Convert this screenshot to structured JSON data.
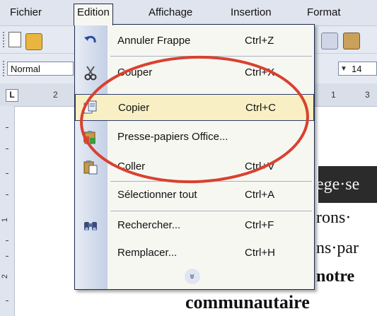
{
  "menubar": {
    "items": [
      "Fichier",
      "Edition",
      "Affichage",
      "Insertion",
      "Format"
    ]
  },
  "toolbar": {
    "style_value": "Normal",
    "font_size_value": "14"
  },
  "ruler": {
    "tab_selector": "L",
    "h_marks": [
      "2",
      "1",
      "3"
    ],
    "v_marks": [
      "1",
      "2"
    ]
  },
  "document": {
    "lines": [
      "ege·se",
      "rons·",
      "ns·par",
      "notre",
      "communautaire"
    ]
  },
  "edit_menu": {
    "items": [
      {
        "label": "Annuler Frappe",
        "shortcut": "Ctrl+Z",
        "icon": "undo-icon"
      },
      {
        "label": "Couper",
        "shortcut": "Ctrl+X",
        "icon": "scissors-icon"
      },
      {
        "label": "Copier",
        "shortcut": "Ctrl+C",
        "icon": "copy-icon",
        "highlighted": true
      },
      {
        "label": "Presse-papiers Office...",
        "shortcut": "",
        "icon": "clipboard-office-icon"
      },
      {
        "label": "Coller",
        "shortcut": "Ctrl+V",
        "icon": "paste-icon"
      },
      {
        "label": "Sélectionner tout",
        "shortcut": "Ctrl+A",
        "icon": ""
      },
      {
        "label": "Rechercher...",
        "shortcut": "Ctrl+F",
        "icon": "binoculars-icon"
      },
      {
        "label": "Remplacer...",
        "shortcut": "Ctrl+H",
        "icon": ""
      }
    ],
    "expand_icon": "double-chevron-down-icon"
  },
  "colors": {
    "annotation_ellipse": "#d9412f",
    "menu_highlight": "#f8f0c4",
    "menu_border": "#1b2a4e"
  }
}
